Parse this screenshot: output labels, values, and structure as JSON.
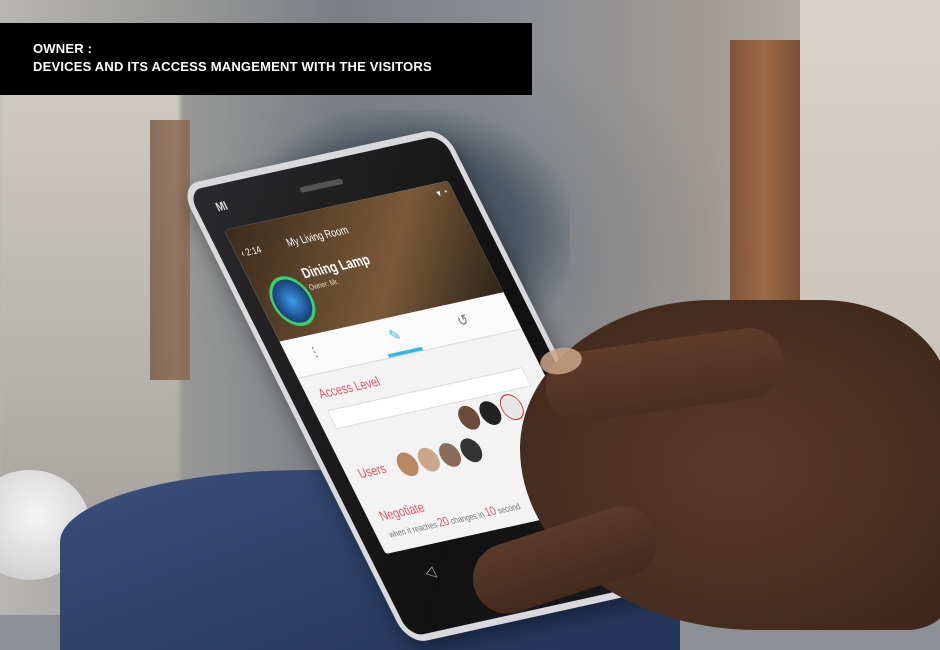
{
  "caption": {
    "line1": "OWNER :",
    "line2": "DEVICES AND ITS ACCESS MANGEMENT WITH THE VISITORS"
  },
  "phone": {
    "brand_logo": "MI",
    "status_time": "2:14",
    "room_title": "My Living Room",
    "device_name": "Dining Lamp",
    "device_subtitle": "Owner: Mr.",
    "sections": {
      "access_level": "Access Level",
      "users": "Users",
      "negotiate": "Negotiate"
    },
    "negotiate": {
      "prefix": "when it reaches",
      "changes_value": "20",
      "changes_label": "changes in",
      "seconds_value": "10",
      "seconds_label": "second"
    },
    "icons": [
      "back-arrow-icon",
      "mixer-icon",
      "edit-pen-icon",
      "history-clock-icon",
      "back-nav-icon",
      "home-nav-icon",
      "menu-nav-icon"
    ]
  },
  "colors": {
    "caption_bg": "#000000",
    "caption_text": "#ffffff",
    "accent_blue": "#2fb8e8",
    "accent_pink": "#e0566a",
    "status_ring": "#3fcf6a"
  }
}
